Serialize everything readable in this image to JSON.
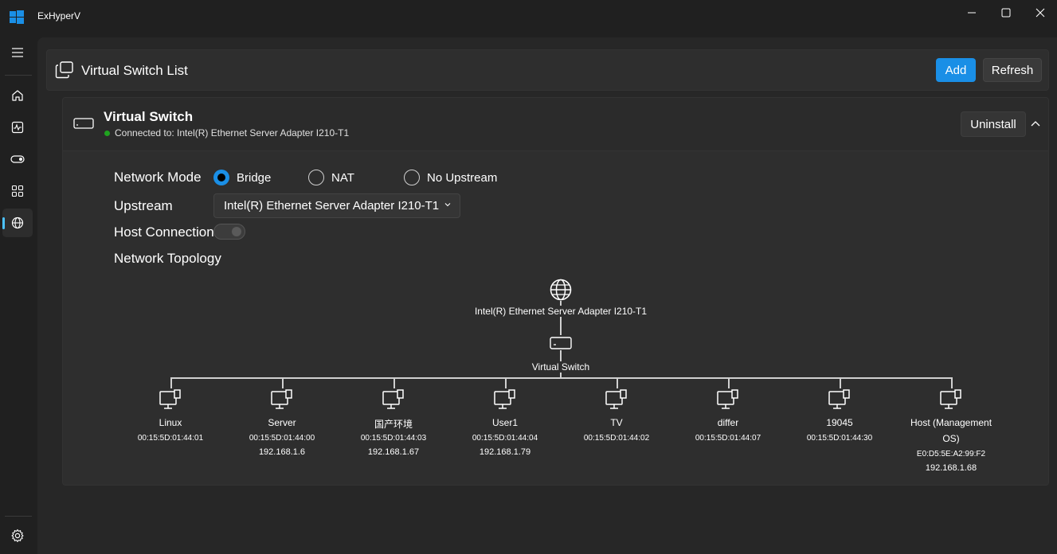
{
  "app": {
    "title": "ExHyperV"
  },
  "sidebar": {
    "items": [
      {
        "icon": "home-icon"
      },
      {
        "icon": "pulse-chart-icon"
      },
      {
        "icon": "toggle-icon"
      },
      {
        "icon": "apps-grid-icon"
      },
      {
        "icon": "globe-icon",
        "active": true
      }
    ],
    "footer_icon": "gear-icon"
  },
  "header": {
    "title": "Virtual Switch List",
    "add_label": "Add",
    "refresh_label": "Refresh"
  },
  "switch": {
    "name": "Virtual Switch",
    "status": "Connected to: Intel(R) Ethernet Server Adapter I210-T1",
    "status_color": "#1fa31f",
    "uninstall_label": "Uninstall",
    "network_mode_label": "Network Mode",
    "modes": [
      "Bridge",
      "NAT",
      "No Upstream"
    ],
    "selected_mode": "Bridge",
    "upstream_label": "Upstream",
    "upstream_value": "Intel(R) Ethernet Server Adapter I210-T1",
    "host_connection_label": "Host Connection",
    "host_connection_on": false,
    "topology_label": "Network Topology"
  },
  "topology": {
    "upstream": "Intel(R) Ethernet Server Adapter I210-T1",
    "switch": "Virtual Switch",
    "nodes": [
      {
        "name": "Linux",
        "mac": "00:15:5D:01:44:01",
        "ip": ""
      },
      {
        "name": "Server",
        "mac": "00:15:5D:01:44:00",
        "ip": "192.168.1.6"
      },
      {
        "name": "国产环境",
        "mac": "00:15:5D:01:44:03",
        "ip": "192.168.1.67"
      },
      {
        "name": "User1",
        "mac": "00:15:5D:01:44:04",
        "ip": "192.168.1.79"
      },
      {
        "name": "TV",
        "mac": "00:15:5D:01:44:02",
        "ip": ""
      },
      {
        "name": "differ",
        "mac": "00:15:5D:01:44:07",
        "ip": ""
      },
      {
        "name": "19045",
        "mac": "00:15:5D:01:44:30",
        "ip": ""
      },
      {
        "name": "Host (Management OS)",
        "name_line1": "Host (Management",
        "name_line2": "OS)",
        "mac": "E0:D5:5E:A2:99:F2",
        "ip": "192.168.1.68"
      }
    ]
  },
  "colors": {
    "accent": "#1a8fe6",
    "indicator": "#4cc2ff"
  }
}
